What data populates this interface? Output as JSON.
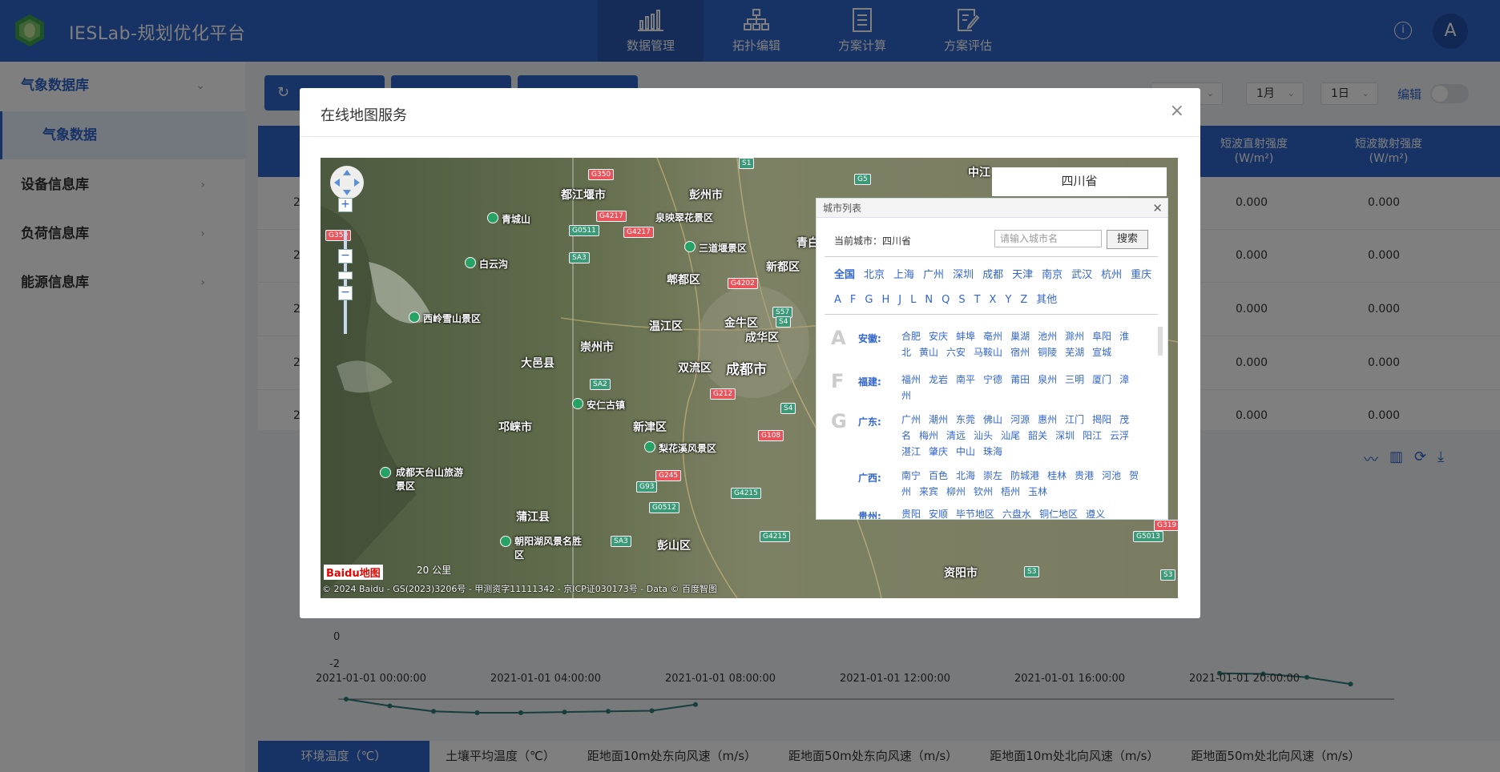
{
  "app": {
    "title": "IESLab-规划优化平台"
  },
  "nav": [
    {
      "label": "数据管理",
      "icon": "bar-chart-icon"
    },
    {
      "label": "拓扑编辑",
      "icon": "topology-icon"
    },
    {
      "label": "方案计算",
      "icon": "document-list-icon"
    },
    {
      "label": "方案评估",
      "icon": "edit-document-icon"
    }
  ],
  "header": {
    "info_icon": "i",
    "avatar": "A"
  },
  "sidebar": {
    "items": [
      {
        "label": "气象数据库"
      },
      {
        "label": "设备信息库"
      },
      {
        "label": "负荷信息库"
      },
      {
        "label": "能源信息库"
      }
    ],
    "sub": "气象数据"
  },
  "filters": {
    "month": "1月",
    "day": "1日",
    "edit_label": "编辑"
  },
  "table": {
    "headers": [
      "短波直射强度\n(W/m²)",
      "短波散射强度\n(W/m²)"
    ],
    "row_prefix": "2",
    "rows": [
      "0.000",
      "0.000",
      "0.000",
      "0.000",
      "0.000"
    ]
  },
  "chart": {
    "yticks": [
      "0",
      "-2"
    ],
    "xticks": [
      "2021-01-01 00:00:00",
      "2021-01-01 04:00:00",
      "2021-01-01 08:00:00",
      "2021-01-01 12:00:00",
      "2021-01-01 16:00:00",
      "2021-01-01 20:00:00"
    ]
  },
  "chart_data": {
    "type": "line",
    "x": [
      "2021-01-01 00:00:00",
      "2021-01-01 01:00:00",
      "2021-01-01 02:00:00",
      "2021-01-01 03:00:00",
      "2021-01-01 04:00:00",
      "2021-01-01 05:00:00",
      "2021-01-01 06:00:00",
      "2021-01-01 07:00:00",
      "2021-01-01 08:00:00",
      "2021-01-01 20:00:00",
      "2021-01-01 21:00:00",
      "2021-01-01 22:00:00",
      "2021-01-01 23:00:00"
    ],
    "series": [
      {
        "values": [
          0,
          -0.5,
          -0.9,
          -1.0,
          -1.0,
          -0.95,
          -0.9,
          -0.85,
          -0.4,
          1.9,
          1.85,
          1.6,
          1.1
        ]
      }
    ],
    "ylim": [
      -2,
      2
    ]
  },
  "bottom_tabs": [
    "环境温度（℃）",
    "土壤平均温度（℃）",
    "距地面10m处东向风速（m/s）",
    "距地面50m处东向风速（m/s）",
    "距地面10m处北向风速（m/s）",
    "距地面50m处北向风速（m/s）"
  ],
  "modal": {
    "title": "在线地图服务",
    "close": "×",
    "province_tab": "四川省",
    "city_panel": {
      "header": "城市列表",
      "close": "✕",
      "current": "当前城市：四川省",
      "search_placeholder": "请输入城市名",
      "search_button": "搜索",
      "hot": [
        "全国",
        "北京",
        "上海",
        "广州",
        "深圳",
        "成都",
        "天津",
        "南京",
        "武汉",
        "杭州",
        "重庆"
      ],
      "letters": [
        "A",
        "F",
        "G",
        "H",
        "J",
        "L",
        "N",
        "Q",
        "S",
        "T",
        "X",
        "Y",
        "Z",
        "其他"
      ],
      "groups": [
        {
          "letter": "A",
          "province": "安徽:",
          "cities": [
            "合肥",
            "安庆",
            "蚌埠",
            "亳州",
            "巢湖",
            "池州",
            "滁州",
            "阜阳",
            "淮北",
            "黄山",
            "六安",
            "马鞍山",
            "宿州",
            "铜陵",
            "芜湖",
            "宣城"
          ]
        },
        {
          "letter": "F",
          "province": "福建:",
          "cities": [
            "福州",
            "龙岩",
            "南平",
            "宁德",
            "莆田",
            "泉州",
            "三明",
            "厦门",
            "漳州"
          ]
        },
        {
          "letter": "G",
          "province": "广东:",
          "cities": [
            "广州",
            "潮州",
            "东莞",
            "佛山",
            "河源",
            "惠州",
            "江门",
            "揭阳",
            "茂名",
            "梅州",
            "清远",
            "汕头",
            "汕尾",
            "韶关",
            "深圳",
            "阳江",
            "云浮",
            "湛江",
            "肇庆",
            "中山",
            "珠海"
          ]
        },
        {
          "letter": "",
          "province": "广西:",
          "cities": [
            "南宁",
            "百色",
            "北海",
            "崇左",
            "防城港",
            "桂林",
            "贵港",
            "河池",
            "贺州",
            "来宾",
            "柳州",
            "钦州",
            "梧州",
            "玉林"
          ]
        },
        {
          "letter": "",
          "province": "贵州:",
          "cities": [
            "贵阳",
            "安顺",
            "毕节地区",
            "六盘水",
            "铜仁地区",
            "遵义"
          ]
        }
      ]
    },
    "map_labels": [
      "都江堰市",
      "彭州市",
      "青城山",
      "泉映翠花景区",
      "白云沟",
      "三道堰景区",
      "郫都区",
      "新都区",
      "青白",
      "西岭雪山景区",
      "温江区",
      "金牛区",
      "成华区",
      "大邑县",
      "崇州市",
      "双流区",
      "成都市",
      "安仁古镇",
      "邛崃市",
      "新津区",
      "梨花溪风景区",
      "成都天台山旅游景区",
      "蒲江县",
      "朝阳湖风景名胜区",
      "彭山区",
      "资阳市",
      "中江"
    ],
    "road_tags": [
      "G350",
      "G4217",
      "G5",
      "S1",
      "G0511",
      "SA3",
      "G4202",
      "G4217",
      "S57",
      "S4",
      "G212",
      "G108",
      "SA2",
      "G245",
      "G93",
      "G0512",
      "G4215",
      "G4215",
      "SA3",
      "G5013",
      "G319",
      "S3",
      "S3",
      "S4",
      "G350"
    ],
    "baidu_logo": "Baidu地图",
    "scale": "20 公里",
    "copyright": "© 2024 Baidu - GS(2023)3206号 - 甲测资字11111342 - 京ICP证030173号 - Data © 百度智图"
  }
}
